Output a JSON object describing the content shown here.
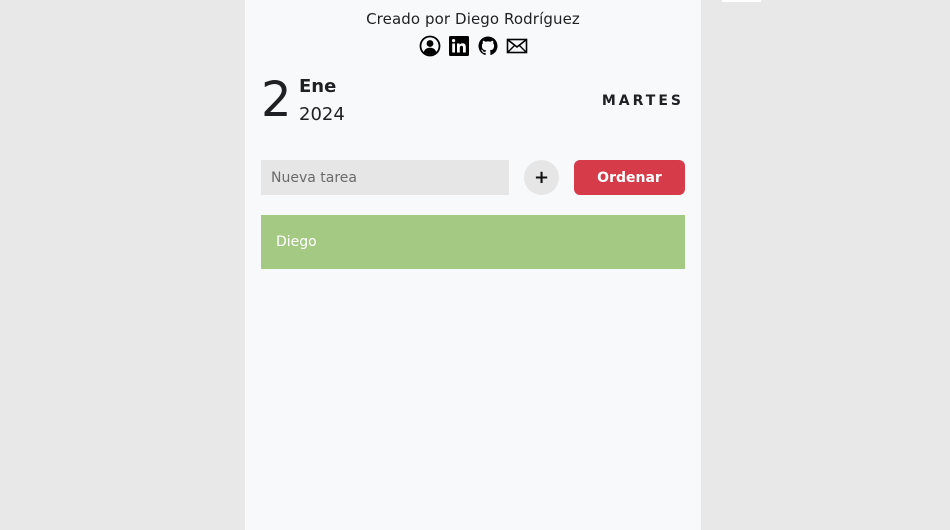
{
  "credits": {
    "text": "Creado por Diego Rodríguez"
  },
  "social_links": [
    {
      "icon": "user-circle-icon"
    },
    {
      "icon": "linkedin-icon"
    },
    {
      "icon": "github-icon"
    },
    {
      "icon": "mail-icon"
    }
  ],
  "date": {
    "day": "2",
    "month": "Ene",
    "year": "2024",
    "weekday": "MARTES"
  },
  "new_task": {
    "placeholder": "Nueva tarea",
    "value": "",
    "add_label": "+"
  },
  "sort_button": {
    "label": "Ordenar"
  },
  "tasks": [
    {
      "text": "Diego"
    }
  ],
  "colors": {
    "background": "#e8e8e8",
    "card": "#f8f9fb",
    "input_bg": "#e6e6e6",
    "accent_red": "#d63b4a",
    "task_green": "#a4c982",
    "text_dark": "#1f2023"
  }
}
